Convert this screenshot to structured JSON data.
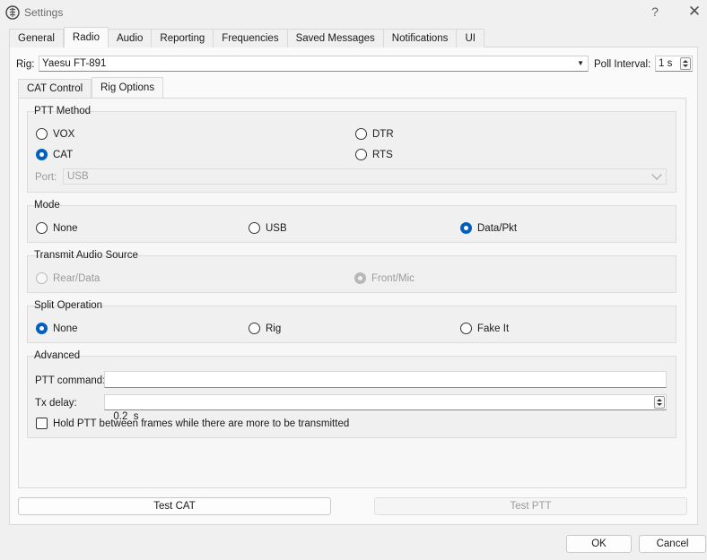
{
  "window": {
    "title": "Settings",
    "help_glyph": "?",
    "close_glyph": "✕"
  },
  "tabs": [
    {
      "label": "General"
    },
    {
      "label": "Radio"
    },
    {
      "label": "Audio"
    },
    {
      "label": "Reporting"
    },
    {
      "label": "Frequencies"
    },
    {
      "label": "Saved Messages"
    },
    {
      "label": "Notifications"
    },
    {
      "label": "UI"
    }
  ],
  "active_tab": "Radio",
  "rig": {
    "label": "Rig:",
    "value": "Yaesu FT-891"
  },
  "poll": {
    "label": "Poll Interval:",
    "value": "1 s"
  },
  "subtabs": [
    {
      "label": "CAT Control"
    },
    {
      "label": "Rig Options"
    }
  ],
  "active_subtab": "Rig Options",
  "ptt": {
    "title": "PTT Method",
    "options": [
      {
        "label": "VOX",
        "checked": false
      },
      {
        "label": "DTR",
        "checked": false
      },
      {
        "label": "CAT",
        "checked": true
      },
      {
        "label": "RTS",
        "checked": false
      }
    ],
    "port_label": "Port:",
    "port_value": "USB"
  },
  "mode": {
    "title": "Mode",
    "options": [
      {
        "label": "None",
        "checked": false
      },
      {
        "label": "USB",
        "checked": false
      },
      {
        "label": "Data/Pkt",
        "checked": true
      }
    ]
  },
  "audio_source": {
    "title": "Transmit Audio Source",
    "options": [
      {
        "label": "Rear/Data",
        "checked": false
      },
      {
        "label": "Front/Mic",
        "checked": true
      }
    ]
  },
  "split": {
    "title": "Split Operation",
    "options": [
      {
        "label": "None",
        "checked": true
      },
      {
        "label": "Rig",
        "checked": false
      },
      {
        "label": "Fake It",
        "checked": false
      }
    ]
  },
  "advanced": {
    "title": "Advanced",
    "ptt_command_label": "PTT command:",
    "ptt_command_value": "",
    "tx_delay_label": "Tx delay:",
    "tx_delay_value": "0.2  s",
    "hold_ptt_label": "Hold PTT between frames while there are more to be transmitted",
    "hold_ptt_checked": false
  },
  "buttons": {
    "test_cat": "Test CAT",
    "test_ptt": "Test PTT",
    "ok": "OK",
    "cancel": "Cancel"
  },
  "colors": {
    "accent": "#0060c0",
    "disabled": "#9a9a9a"
  }
}
